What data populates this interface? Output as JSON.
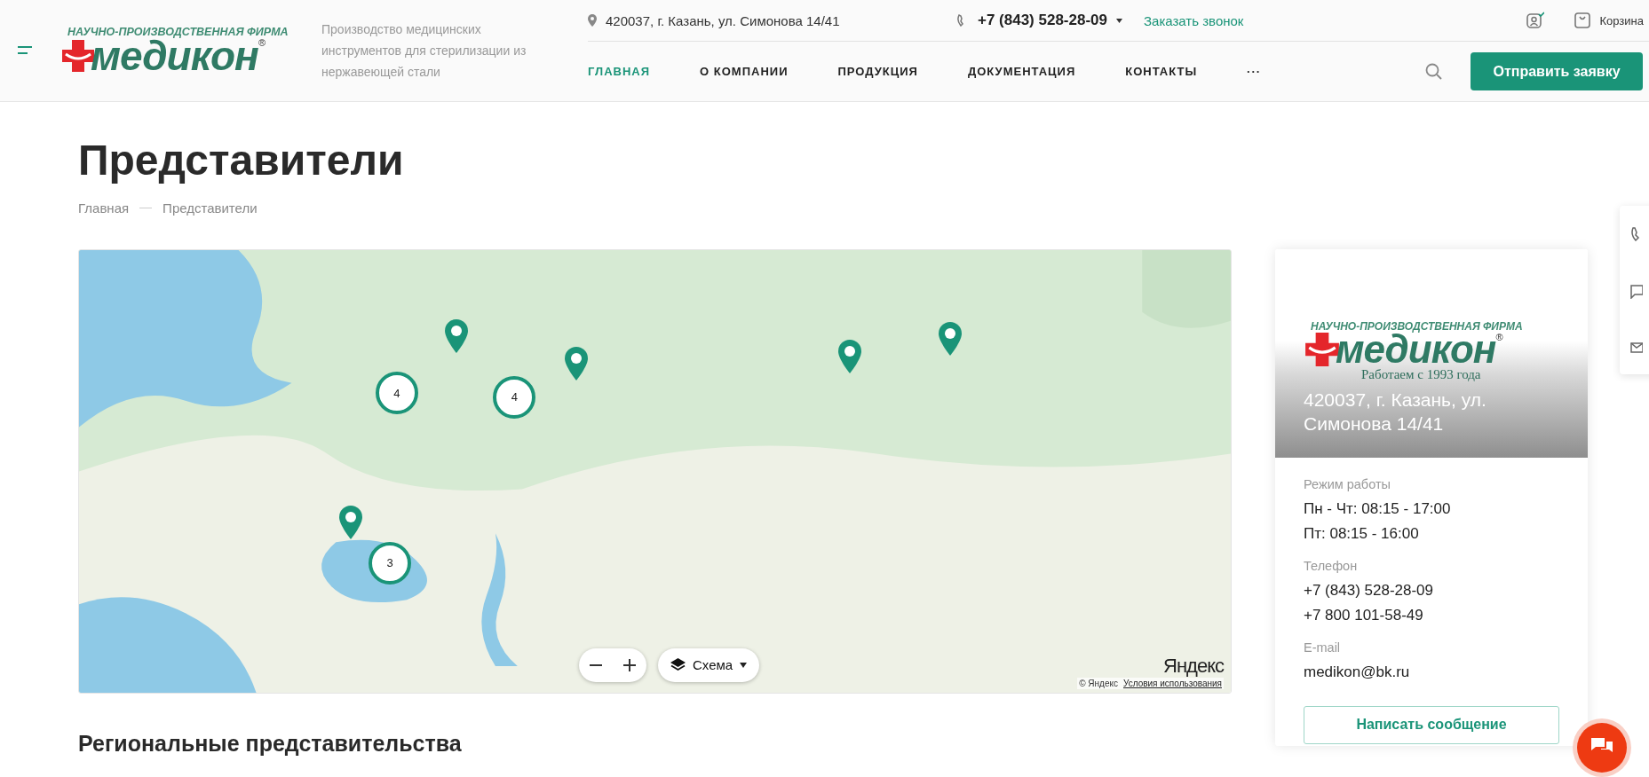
{
  "header": {
    "logo": {
      "caption": "НАУЧНО-ПРОИЗВОДСТВЕННАЯ ФИРМА",
      "word": "медикон",
      "mark": "®"
    },
    "tagline": "Производство медицинских инструментов для стерилизации из нержавеющей стали",
    "address": "420037, г. Казань, ул. Симонова 14/41",
    "phone": "+7 (843) 528-28-09",
    "callback": "Заказать звонок",
    "cart": "Корзина",
    "nav": [
      {
        "label": "ГЛАВНАЯ",
        "selected": true
      },
      {
        "label": "О КОМПАНИИ",
        "selected": false
      },
      {
        "label": "ПРОДУКЦИЯ",
        "selected": false
      },
      {
        "label": "ДОКУМЕНТАЦИЯ",
        "selected": false
      },
      {
        "label": "КОНТАКТЫ",
        "selected": false
      },
      {
        "label": "···",
        "selected": false
      }
    ],
    "request_button": "Отправить заявку"
  },
  "page": {
    "title": "Представители",
    "breadcrumbs": [
      "Главная",
      "Представители"
    ]
  },
  "map": {
    "markers": [
      {
        "kind": "cluster",
        "count": "4"
      },
      {
        "kind": "pin"
      },
      {
        "kind": "cluster",
        "count": "4"
      },
      {
        "kind": "pin"
      },
      {
        "kind": "pin"
      },
      {
        "kind": "pin"
      },
      {
        "kind": "pin"
      },
      {
        "kind": "cluster",
        "count": "3"
      }
    ],
    "layer_button": "Схема",
    "brand": "Яндекс",
    "copyright": "© Яндекс",
    "terms": "Условия использования"
  },
  "card": {
    "logo": {
      "caption": "НАУЧНО-ПРОИЗВОДСТВЕННАЯ ФИРМА",
      "word": "медикон",
      "mark": "®",
      "slogan": "Работаем с 1993 года"
    },
    "address": "420037, г. Казань, ул. Симонова 14/41",
    "sections": [
      {
        "label": "Режим работы",
        "lines": [
          "Пн - Чт: 08:15 - 17:00",
          "Пт: 08:15 - 16:00"
        ]
      },
      {
        "label": "Телефон",
        "lines": [
          "+7 (843) 528-28-09",
          "+7 800 101-58-49"
        ]
      },
      {
        "label": "E-mail",
        "lines": [
          "medikon@bk.ru"
        ]
      }
    ],
    "button": "Написать сообщение"
  },
  "section_title": "Региональные представительства"
}
